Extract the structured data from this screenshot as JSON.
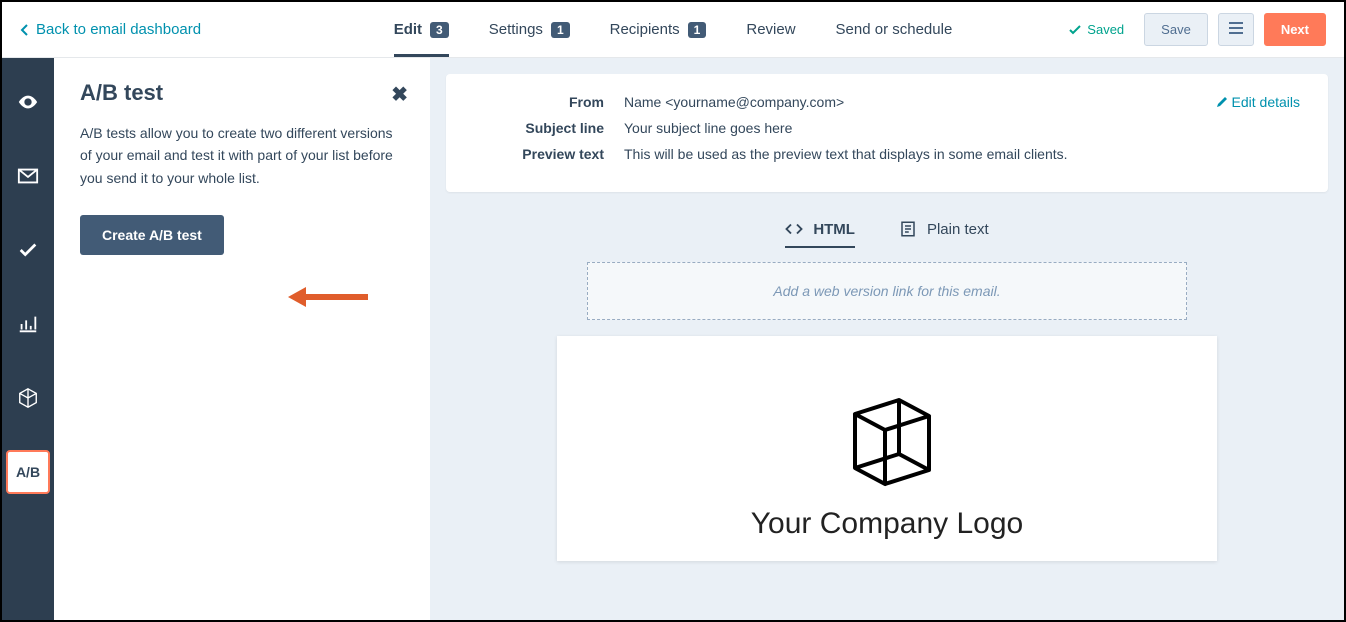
{
  "header": {
    "back_label": "Back to email dashboard",
    "tabs": [
      {
        "label": "Edit",
        "badge": "3",
        "active": true
      },
      {
        "label": "Settings",
        "badge": "1"
      },
      {
        "label": "Recipients",
        "badge": "1"
      },
      {
        "label": "Review"
      },
      {
        "label": "Send or schedule"
      }
    ],
    "saved_label": "Saved",
    "save_label": "Save",
    "next_label": "Next"
  },
  "rail": {
    "ab_label": "A/B"
  },
  "panel": {
    "title": "A/B test",
    "description": "A/B tests allow you to create two different versions of your email and test it with part of your list before you send it to your whole list.",
    "create_label": "Create A/B test"
  },
  "details": {
    "from_label": "From",
    "from_value": "Name <yourname@company.com>",
    "subject_label": "Subject line",
    "subject_value": "Your subject line goes here",
    "preview_label": "Preview text",
    "preview_value": "This will be used as the preview text that displays in some email clients.",
    "edit_label": "Edit details"
  },
  "view": {
    "html_label": "HTML",
    "plain_label": "Plain text",
    "web_version_hint": "Add a web version link for this email.",
    "logo_text": "Your Company Logo"
  }
}
